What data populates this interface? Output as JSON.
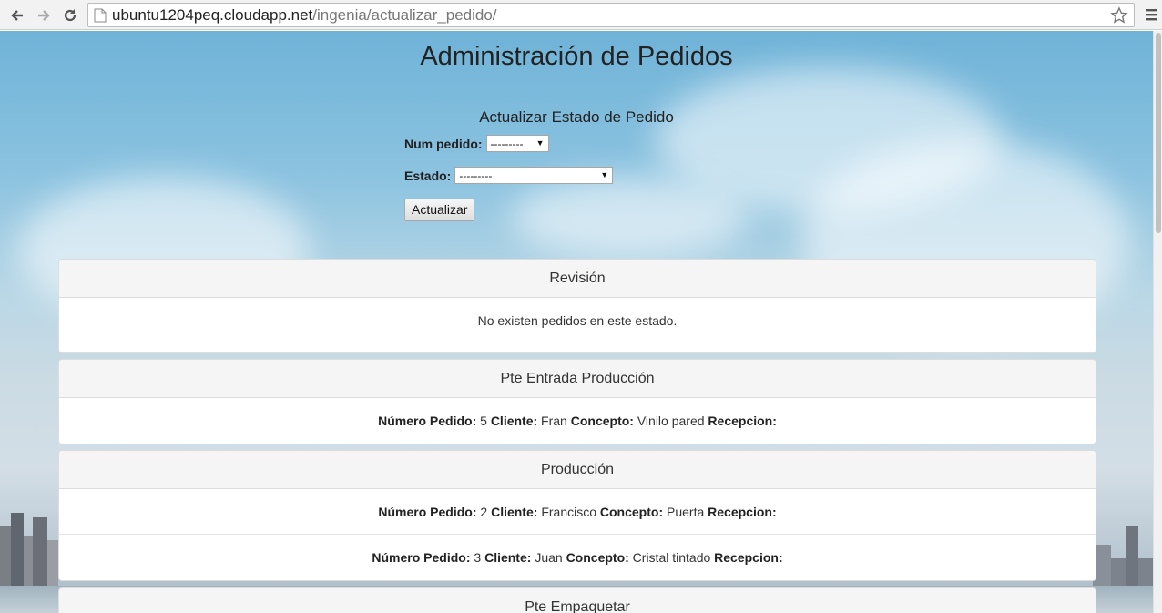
{
  "browser": {
    "url_host": "ubuntu1204peq.cloudapp.net",
    "url_path": "/ingenia/actualizar_pedido/"
  },
  "page": {
    "title": "Administración de Pedidos"
  },
  "form": {
    "title": "Actualizar Estado de Pedido",
    "num_pedido_label": "Num pedido:",
    "num_pedido_value": "---------",
    "estado_label": "Estado:",
    "estado_value": "---------",
    "submit_label": "Actualizar"
  },
  "labels": {
    "numero": "Número Pedido:",
    "cliente": "Cliente:",
    "concepto": "Concepto:",
    "recepcion": "Recepcion:"
  },
  "panels": [
    {
      "heading": "Revisión",
      "empty_text": "No existen pedidos en este estado."
    },
    {
      "heading": "Pte Entrada Producción",
      "orders": [
        {
          "numero": "5",
          "cliente": "Fran",
          "concepto": "Vinilo pared"
        }
      ]
    },
    {
      "heading": "Producción",
      "orders": [
        {
          "numero": "2",
          "cliente": "Francisco",
          "concepto": "Puerta"
        },
        {
          "numero": "3",
          "cliente": "Juan",
          "concepto": "Cristal tintado"
        }
      ]
    },
    {
      "heading": "Pte Empaquetar"
    }
  ]
}
